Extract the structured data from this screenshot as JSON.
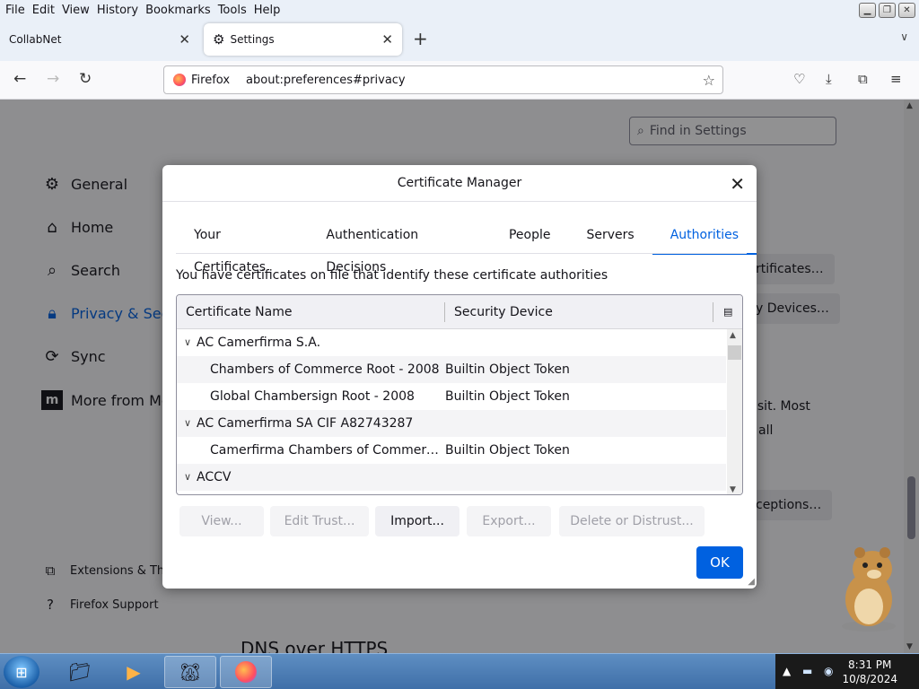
{
  "menubar": {
    "items": [
      "File",
      "Edit",
      "View",
      "History",
      "Bookmarks",
      "Tools",
      "Help"
    ]
  },
  "tabs": [
    {
      "label": "CollabNet",
      "icon": "none"
    },
    {
      "label": "Settings",
      "icon": "gear-icon"
    }
  ],
  "navbar": {
    "identity_label": "Firefox",
    "url": "about:preferences#privacy"
  },
  "settings": {
    "find_placeholder": "Find in Settings",
    "categories": [
      "General",
      "Home",
      "Search",
      "Privacy & Secu",
      "Sync",
      "More from Mo"
    ],
    "footer_links": [
      "Extensions & The",
      "Firefox Support"
    ],
    "bg_buttons": [
      "rtificates…",
      "y Devices…",
      "ceptions…"
    ],
    "bg_text_1": "isit. Most",
    "bg_text_2": "all",
    "dns_heading": "DNS over HTTPS"
  },
  "dialog": {
    "title": "Certificate Manager",
    "tabs": [
      "Your Certificates",
      "Authentication Decisions",
      "People",
      "Servers",
      "Authorities"
    ],
    "active_tab": "Authorities",
    "description": "You have certificates on file that identify these certificate authorities",
    "columns": [
      "Certificate Name",
      "Security Device"
    ],
    "rows": [
      {
        "type": "group",
        "name": "AC Camerfirma S.A.",
        "device": ""
      },
      {
        "type": "cert",
        "name": "Chambers of Commerce Root - 2008",
        "device": "Builtin Object Token"
      },
      {
        "type": "cert",
        "name": "Global Chambersign Root - 2008",
        "device": "Builtin Object Token"
      },
      {
        "type": "group",
        "name": "AC Camerfirma SA CIF A82743287",
        "device": ""
      },
      {
        "type": "cert",
        "name": "Camerfirma Chambers of Commerce ...",
        "device": "Builtin Object Token"
      },
      {
        "type": "group",
        "name": "ACCV",
        "device": ""
      }
    ],
    "buttons": {
      "view": "View...",
      "edit_trust": "Edit Trust...",
      "import": "Import...",
      "export": "Export...",
      "delete": "Delete or Distrust..."
    },
    "ok": "OK"
  },
  "taskbar": {
    "time": "8:31 PM",
    "date": "10/8/2024"
  },
  "colors": {
    "accent": "#0061e0",
    "taskbar": "#4a7bb5"
  }
}
